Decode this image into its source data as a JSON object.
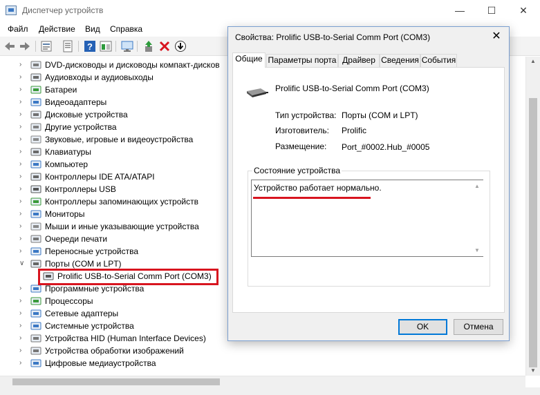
{
  "window": {
    "title": "Диспетчер устройств",
    "min_glyph": "—",
    "max_glyph": "☐",
    "close_glyph": "✕"
  },
  "menu": [
    "Файл",
    "Действие",
    "Вид",
    "Справка"
  ],
  "toolbar": {
    "icons": [
      "back-arrow-icon",
      "forward-arrow-icon",
      "properties-icon",
      "list-icon",
      "help-icon",
      "view-icon",
      "monitor-icon",
      "update-driver-icon",
      "uninstall-icon",
      "download-icon"
    ],
    "colors": {
      "delete": "#d8141f",
      "help": "#2561b5",
      "green": "#2e9b3c"
    }
  },
  "tree": [
    {
      "label": "DVD-дисководы и дисководы компакт-дисков",
      "icon": "dvd-icon",
      "expanded": false
    },
    {
      "label": "Аудиовходы и аудиовыходы",
      "icon": "audio-icon",
      "expanded": false
    },
    {
      "label": "Батареи",
      "icon": "battery-icon",
      "expanded": false
    },
    {
      "label": "Видеоадаптеры",
      "icon": "video-adapter-icon",
      "expanded": false
    },
    {
      "label": "Дисковые устройства",
      "icon": "disk-icon",
      "expanded": false
    },
    {
      "label": "Другие устройства",
      "icon": "other-devices-icon",
      "expanded": false
    },
    {
      "label": "Звуковые, игровые и видеоустройства",
      "icon": "sound-icon",
      "expanded": false
    },
    {
      "label": "Клавиатуры",
      "icon": "keyboard-icon",
      "expanded": false
    },
    {
      "label": "Компьютер",
      "icon": "computer-icon",
      "expanded": false
    },
    {
      "label": "Контроллеры IDE ATA/ATAPI",
      "icon": "ide-icon",
      "expanded": false
    },
    {
      "label": "Контроллеры USB",
      "icon": "usb-icon",
      "expanded": false
    },
    {
      "label": "Контроллеры запоминающих устройств",
      "icon": "storage-icon",
      "expanded": false
    },
    {
      "label": "Мониторы",
      "icon": "monitor-icon",
      "expanded": false
    },
    {
      "label": "Мыши и иные указывающие устройства",
      "icon": "mouse-icon",
      "expanded": false
    },
    {
      "label": "Очереди печати",
      "icon": "print-queue-icon",
      "expanded": false
    },
    {
      "label": "Переносные устройства",
      "icon": "portable-icon",
      "expanded": false
    },
    {
      "label": "Порты (COM и LPT)",
      "icon": "port-icon",
      "expanded": true
    },
    {
      "label": "Prolific USB-to-Serial Comm Port (COM3)",
      "icon": "serial-port-icon",
      "child": true
    },
    {
      "label": "Программные устройства",
      "icon": "software-device-icon",
      "expanded": false
    },
    {
      "label": "Процессоры",
      "icon": "processor-icon",
      "expanded": false
    },
    {
      "label": "Сетевые адаптеры",
      "icon": "network-icon",
      "expanded": false
    },
    {
      "label": "Системные устройства",
      "icon": "system-icon",
      "expanded": false
    },
    {
      "label": "Устройства HID (Human Interface Devices)",
      "icon": "hid-icon",
      "expanded": false
    },
    {
      "label": "Устройства обработки изображений",
      "icon": "imaging-icon",
      "expanded": false
    },
    {
      "label": "Цифровые медиаустройства",
      "icon": "media-icon",
      "expanded": false
    }
  ],
  "dialog": {
    "title": "Свойства: Prolific USB-to-Serial Comm Port (COM3)",
    "close_glyph": "✕",
    "tabs": [
      "Общие",
      "Параметры порта",
      "Драйвер",
      "Сведения",
      "События"
    ],
    "active_tab": "Общие",
    "device_name": "Prolific USB-to-Serial Comm Port (COM3)",
    "properties": [
      {
        "label": "Тип устройства:",
        "value": "Порты (COM и LPT)"
      },
      {
        "label": "Изготовитель:",
        "value": "Prolific"
      },
      {
        "label": "Размещение:",
        "value": "Port_#0002.Hub_#0005"
      }
    ],
    "status_group_title": "Состояние устройства",
    "status_text": "Устройство работает нормально.",
    "ok_label": "OK",
    "cancel_label": "Отмена"
  },
  "accent": {
    "highlight": "#d8141f",
    "focus": "#0078d7"
  }
}
